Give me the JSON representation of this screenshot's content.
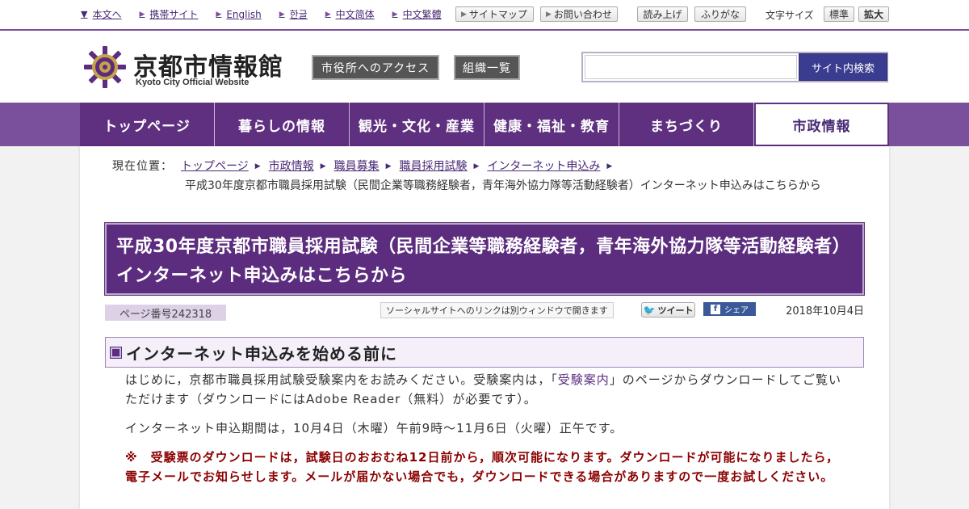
{
  "utility": {
    "links": [
      {
        "label": "本文へ",
        "icon": "down-triangle-icon"
      },
      {
        "label": "携帯サイト",
        "icon": "right-triangle-icon"
      },
      {
        "label": "English",
        "icon": "right-triangle-icon"
      },
      {
        "label": "한글",
        "icon": "right-triangle-icon"
      },
      {
        "label": "中文简体",
        "icon": "right-triangle-icon"
      },
      {
        "label": "中文繁體",
        "icon": "right-triangle-icon"
      }
    ],
    "sitemap": "サイトマップ",
    "contact": "お問い合わせ",
    "read_aloud": "読み上げ",
    "furigana": "ふりがな",
    "font_size_label": "文字サイズ",
    "font_standard": "標準",
    "font_large": "拡大"
  },
  "header": {
    "site_name": "京都市情報館",
    "site_sub": "Kyoto City Official Website",
    "access_button": "市役所へのアクセス",
    "org_button": "組織一覧",
    "search_placeholder": "",
    "search_button": "サイト内検索"
  },
  "nav": {
    "items": [
      {
        "label": "トップページ"
      },
      {
        "label": "暮らしの情報"
      },
      {
        "label": "観光・文化・産業"
      },
      {
        "label": "健康・福祉・教育"
      },
      {
        "label": "まちづくり"
      },
      {
        "label": "市政情報"
      }
    ],
    "active_index": 5
  },
  "breadcrumb": {
    "label": "現在位置：",
    "items": [
      "トップページ",
      "市政情報",
      "職員募集",
      "職員採用試験",
      "インターネット申込み"
    ],
    "current": "平成30年度京都市職員採用試験（民間企業等職務経験者，青年海外協力隊等活動経験者）インターネット申込みはこちらから"
  },
  "page": {
    "title": "平成30年度京都市職員採用試験（民間企業等職務経験者，青年海外協力隊等活動経験者）インターネット申込みはこちらから",
    "page_number": "ページ番号242318",
    "social_note": "ソーシャルサイトへのリンクは別ウィンドウで開きます",
    "tweet": "ツイート",
    "share": "シェア",
    "date": "2018年10月4日"
  },
  "section": {
    "heading": "インターネット申込みを始める前に",
    "p1_before": "はじめに，京都市職員採用試験受験案内をお読みください。受験案内は，「",
    "p1_link": "受験案内",
    "p1_after": "」のページからダウンロードしてご覧いただけます（ダウンロードにはAdobe Reader（無料）が必要です）。",
    "p2": "インターネット申込期間は，10月4日（木曜）午前9時～11月6日（火曜）正午です。",
    "warning": "※　受験票のダウンロードは，試験日のおおむね12日前から，順次可能になります。ダウンロードが可能になりましたら，電子メールでお知らせします。メールが届かない場合でも，ダウンロードできる場合がありますので一度お試しください。"
  },
  "colors": {
    "brand_purple": "#5c2d7e",
    "nav_band": "#7a4f9c",
    "search_button": "#3a3d8f",
    "warning_text": "#8b0000"
  }
}
